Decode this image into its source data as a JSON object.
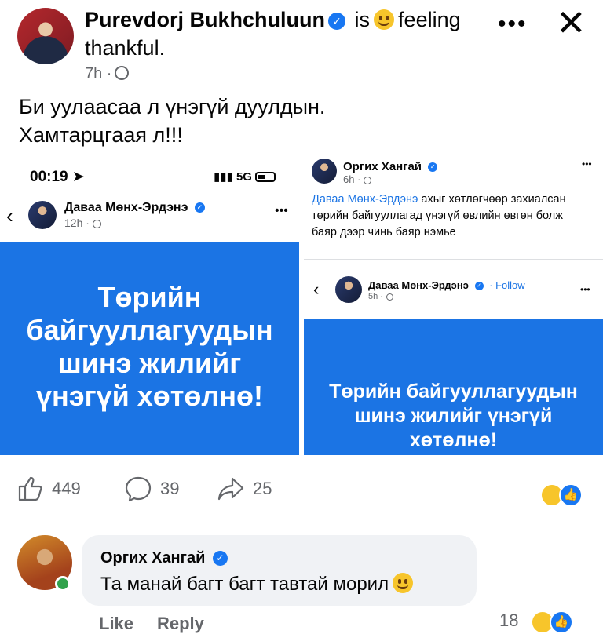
{
  "post": {
    "author": "Purevdorj Bukhchuluun",
    "is_text": "is",
    "feeling_line1": "feeling",
    "feeling_line2": "thankful.",
    "time": "7h ·",
    "caption": "Би уулаасаа л үнэгүй дуулдын.\nХамтарцгаая л!!!"
  },
  "left_image": {
    "status_time": "00:19",
    "network": "5G",
    "author": "Даваа Мөнх-Эрдэнэ",
    "time": "12h ·",
    "banner_text": "Төрийн байгууллагуудын шинэ жилийг үнэгүй хөтөлнө!"
  },
  "right_image": {
    "author": "Оргих Хангай",
    "time": "6h ·",
    "mention": "Даваа Мөнх-Эрдэнэ",
    "body": " ахыг хөтлөгчөөр захиалсан төрийн байгууллагад үнэгүй өвлийн өвгөн болж баяр дээр чинь баяр нэмье",
    "shared_author": "Даваа Мөнх-Эрдэнэ",
    "follow": "· Follow",
    "shared_time": "5h ·",
    "banner_text": "Төрийн байгууллагуудын шинэ жилийг үнэгүй хөтөлнө!"
  },
  "actions": {
    "likes": "449",
    "comments": "39",
    "shares": "25"
  },
  "comment": {
    "author": "Оргих Хангай",
    "text": "Та манай багт багт тавтай морил",
    "like_label": "Like",
    "reply_label": "Reply",
    "reaction_count": "18"
  },
  "icons": {
    "verified": "verified-badge-icon",
    "globe": "globe-icon",
    "more": "more-dots-icon",
    "close": "close-icon",
    "like": "thumbs-up-icon",
    "comment": "comment-icon",
    "share": "share-icon"
  },
  "colors": {
    "brand_blue": "#1877f2",
    "banner_blue": "#1b74e4",
    "secondary_text": "#65676b",
    "bubble_bg": "#f0f2f5"
  }
}
